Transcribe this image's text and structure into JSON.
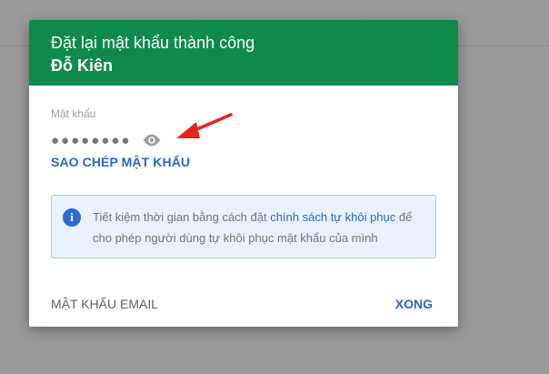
{
  "dialog": {
    "title": "Đặt lại mật khẩu thành công",
    "user_name": "Đỗ Kiên",
    "header_color": "#0f8a4d",
    "password_label": "Mật khẩu",
    "password_mask": "●●●●●●●●",
    "show_password_icon": "eye-icon",
    "copy_password_label": "SAO CHÉP MẬT KHẨU",
    "info": {
      "icon": "info-icon",
      "text_before": "Tiết kiệm thời gian bằng cách đặt ",
      "link_text": "chính sách tự khôi phục",
      "text_after": " để cho phép người dùng tự khôi phục mật khẩu của mình"
    },
    "footer": {
      "email_password_label": "MẬT KHẨU EMAIL",
      "done_label": "XONG"
    }
  },
  "annotation": {
    "arrow_color": "#e8231c"
  }
}
